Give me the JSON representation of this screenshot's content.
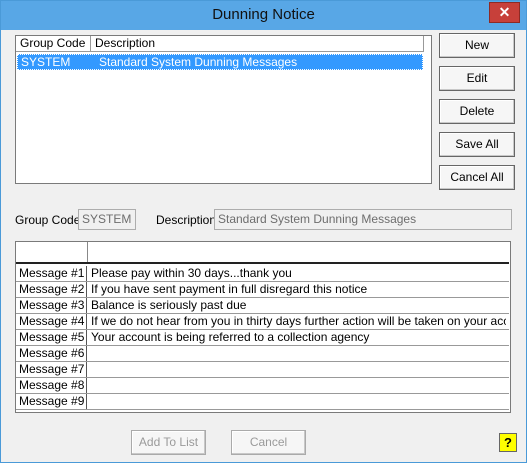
{
  "window": {
    "title": "Dunning Notice",
    "close_glyph": "✕"
  },
  "group_list": {
    "columns": [
      "Group Code",
      "Description"
    ],
    "rows": [
      {
        "code": "SYSTEM",
        "description": "Standard System Dunning Messages"
      }
    ]
  },
  "buttons": {
    "new": "New",
    "edit": "Edit",
    "delete": "Delete",
    "save_all": "Save All",
    "cancel_all": "Cancel All",
    "add_to_list": "Add To List",
    "cancel": "Cancel",
    "help": "?"
  },
  "fields": {
    "group_code_label": "Group Code:",
    "group_code_value": "SYSTEM",
    "description_label": "Description",
    "description_value": "Standard System Dunning Messages"
  },
  "messages": [
    {
      "label": "Message #1",
      "text": "Please pay within 30 days...thank you"
    },
    {
      "label": "Message #2",
      "text": "If you have sent payment in full disregard this notice"
    },
    {
      "label": "Message #3",
      "text": "Balance is seriously past due"
    },
    {
      "label": "Message #4",
      "text": "If we do not hear from you in thirty days further action will be taken on your account"
    },
    {
      "label": "Message #5",
      "text": "Your account is being referred to a collection agency"
    },
    {
      "label": "Message #6",
      "text": ""
    },
    {
      "label": "Message #7",
      "text": ""
    },
    {
      "label": "Message #8",
      "text": ""
    },
    {
      "label": "Message #9",
      "text": ""
    }
  ]
}
